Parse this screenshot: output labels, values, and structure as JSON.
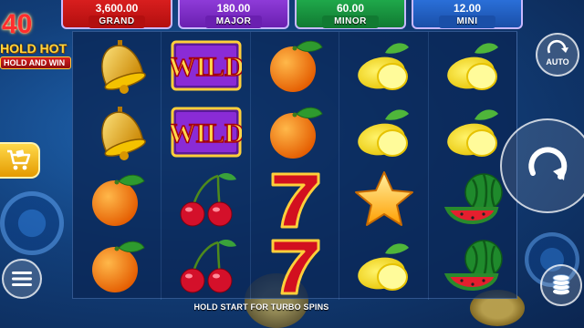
{
  "logo": {
    "number": "40",
    "line1": "HOLD HOT",
    "line2": "HOLD AND WIN"
  },
  "jackpots": [
    {
      "value": "3,600.00",
      "name": "GRAND",
      "color": "#d81e1e",
      "band": "#b30f0f"
    },
    {
      "value": "180.00",
      "name": "MAJOR",
      "color": "#8e3bd8",
      "band": "#6a1fb0"
    },
    {
      "value": "60.00",
      "name": "MINOR",
      "color": "#1fa84a",
      "band": "#117a32"
    },
    {
      "value": "12.00",
      "name": "MINI",
      "color": "#2a6fd8",
      "band": "#1a4fa8"
    }
  ],
  "reels": [
    [
      "bell",
      "bell",
      "orange",
      "orange"
    ],
    [
      "wild",
      "wild",
      "cherries",
      "cherries"
    ],
    [
      "orange",
      "orange",
      "seven",
      "seven"
    ],
    [
      "lemon",
      "lemon",
      "star",
      "lemon"
    ],
    [
      "lemon",
      "lemon",
      "watermelon",
      "watermelon"
    ]
  ],
  "symbol_icons": {
    "bell": "bell-icon",
    "wild": "wild-icon",
    "orange": "orange-icon",
    "cherries": "cherries-icon",
    "seven": "seven-icon",
    "lemon": "lemon-icon",
    "star": "star-icon",
    "watermelon": "watermelon-icon"
  },
  "wild_text": "WILD",
  "buttons": {
    "auto_label": "AUTO",
    "spin_icon": "spin-icon",
    "menu_icon": "menu-icon",
    "bet_icon": "coins-icon",
    "buy_icon": "cart-icon"
  },
  "message": "HOLD START FOR TURBO SPINS"
}
